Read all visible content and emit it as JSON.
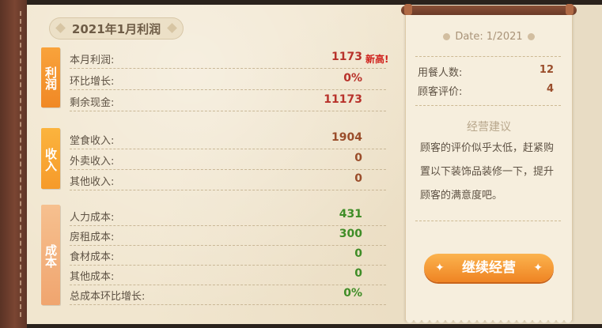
{
  "report": {
    "title": "2021年1月利润",
    "sections": {
      "profit": {
        "tag": "利润"
      },
      "income": {
        "tag": "收入"
      },
      "cost": {
        "tag": "成本"
      }
    },
    "rows": [
      {
        "label": "本月利润:",
        "value": "1173"
      },
      {
        "label": "环比增长:",
        "value": "0%"
      },
      {
        "label": "剩余现金:",
        "value": "11173"
      },
      {
        "label": "堂食收入:",
        "value": "1904"
      },
      {
        "label": "外卖收入:",
        "value": "0"
      },
      {
        "label": "其他收入:",
        "value": "0"
      },
      {
        "label": "人力成本:",
        "value": "431"
      },
      {
        "label": "房租成本:",
        "value": "300"
      },
      {
        "label": "食材成本:",
        "value": "0"
      },
      {
        "label": "其他成本:",
        "value": "0"
      },
      {
        "label": "总成本环比增长:",
        "value": "0%"
      }
    ],
    "badge": "新高!"
  },
  "summary": {
    "date": "Date:  1/2021",
    "diners_label": "用餐人数:",
    "diners_value": "12",
    "rating_label": "顾客评价:",
    "rating_value": "4",
    "advice_title": "经营建议",
    "advice_text": "顾客的评价似乎太低，赶紧购置以下装饰品装修一下，提升顾客的满意度吧。",
    "continue_button": "继续经营"
  }
}
